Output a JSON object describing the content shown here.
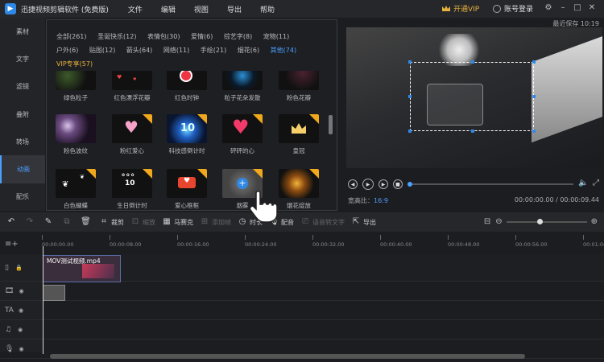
{
  "app": {
    "title": "迅捷视频剪辑软件 (免费版)"
  },
  "menu": [
    "文件",
    "编辑",
    "视图",
    "导出",
    "帮助"
  ],
  "account": {
    "vip_label": "开通VIP",
    "login_label": "账号登录"
  },
  "sidebar": [
    {
      "label": "素材"
    },
    {
      "label": "文字"
    },
    {
      "label": "滤镜"
    },
    {
      "label": "叠附"
    },
    {
      "label": "转场"
    },
    {
      "label": "动画",
      "active": true
    },
    {
      "label": "配乐"
    }
  ],
  "categories": [
    {
      "label": "全部(261)"
    },
    {
      "label": "圣诞快乐(12)"
    },
    {
      "label": "表情包(30)"
    },
    {
      "label": "爱情(6)"
    },
    {
      "label": "综艺字(8)"
    },
    {
      "label": "宠物(11)"
    },
    {
      "label": "户外(6)"
    },
    {
      "label": "贴图(12)"
    },
    {
      "label": "箭头(64)"
    },
    {
      "label": "网络(11)"
    },
    {
      "label": "手绘(21)"
    },
    {
      "label": "烟花(6)"
    },
    {
      "label": "其他(74)",
      "selected": true
    },
    {
      "label": "VIP专享(57)",
      "vip": true
    }
  ],
  "effects": [
    {
      "caption": "绿色粒子"
    },
    {
      "caption": "红色漂浮花瓣"
    },
    {
      "caption": "红色时钟"
    },
    {
      "caption": "粒子花朵发散"
    },
    {
      "caption": "粉色花瓣"
    },
    {
      "caption": "粉色波纹"
    },
    {
      "caption": "粉红爱心"
    },
    {
      "caption": "科技感倒计时"
    },
    {
      "caption": "砰砰的心"
    },
    {
      "caption": "皇冠"
    },
    {
      "caption": "白色蝴蝶"
    },
    {
      "caption": "生日倒计时"
    },
    {
      "caption": "爱心框框"
    },
    {
      "caption": "烟雾"
    },
    {
      "caption": "烟花绽放"
    }
  ],
  "preview": {
    "autosave": "最近保存 10:19",
    "ratio_label": "宽高比：",
    "ratio_value": "16:9",
    "time": "00:00:00.00 / 00:00:09.44",
    "progress": 0.0
  },
  "toolbar": {
    "crop": "裁剪",
    "zoom": "缩放",
    "mosaic": "马赛克",
    "add_frame": "添加帧",
    "duration": "时长",
    "dub": "配音",
    "tts": "语音转文字",
    "export": "导出"
  },
  "timeline": {
    "ticks": [
      "00:00:00.00",
      "00:00:08.00",
      "00:00:16.00",
      "00:00:24.00",
      "00:00:32.00",
      "00:00:40.00",
      "00:00:48.00",
      "00:00:56.00",
      "00:01:04.00"
    ],
    "clip_name": "MOV测试视频.mp4",
    "zoom_level": 0.38
  }
}
